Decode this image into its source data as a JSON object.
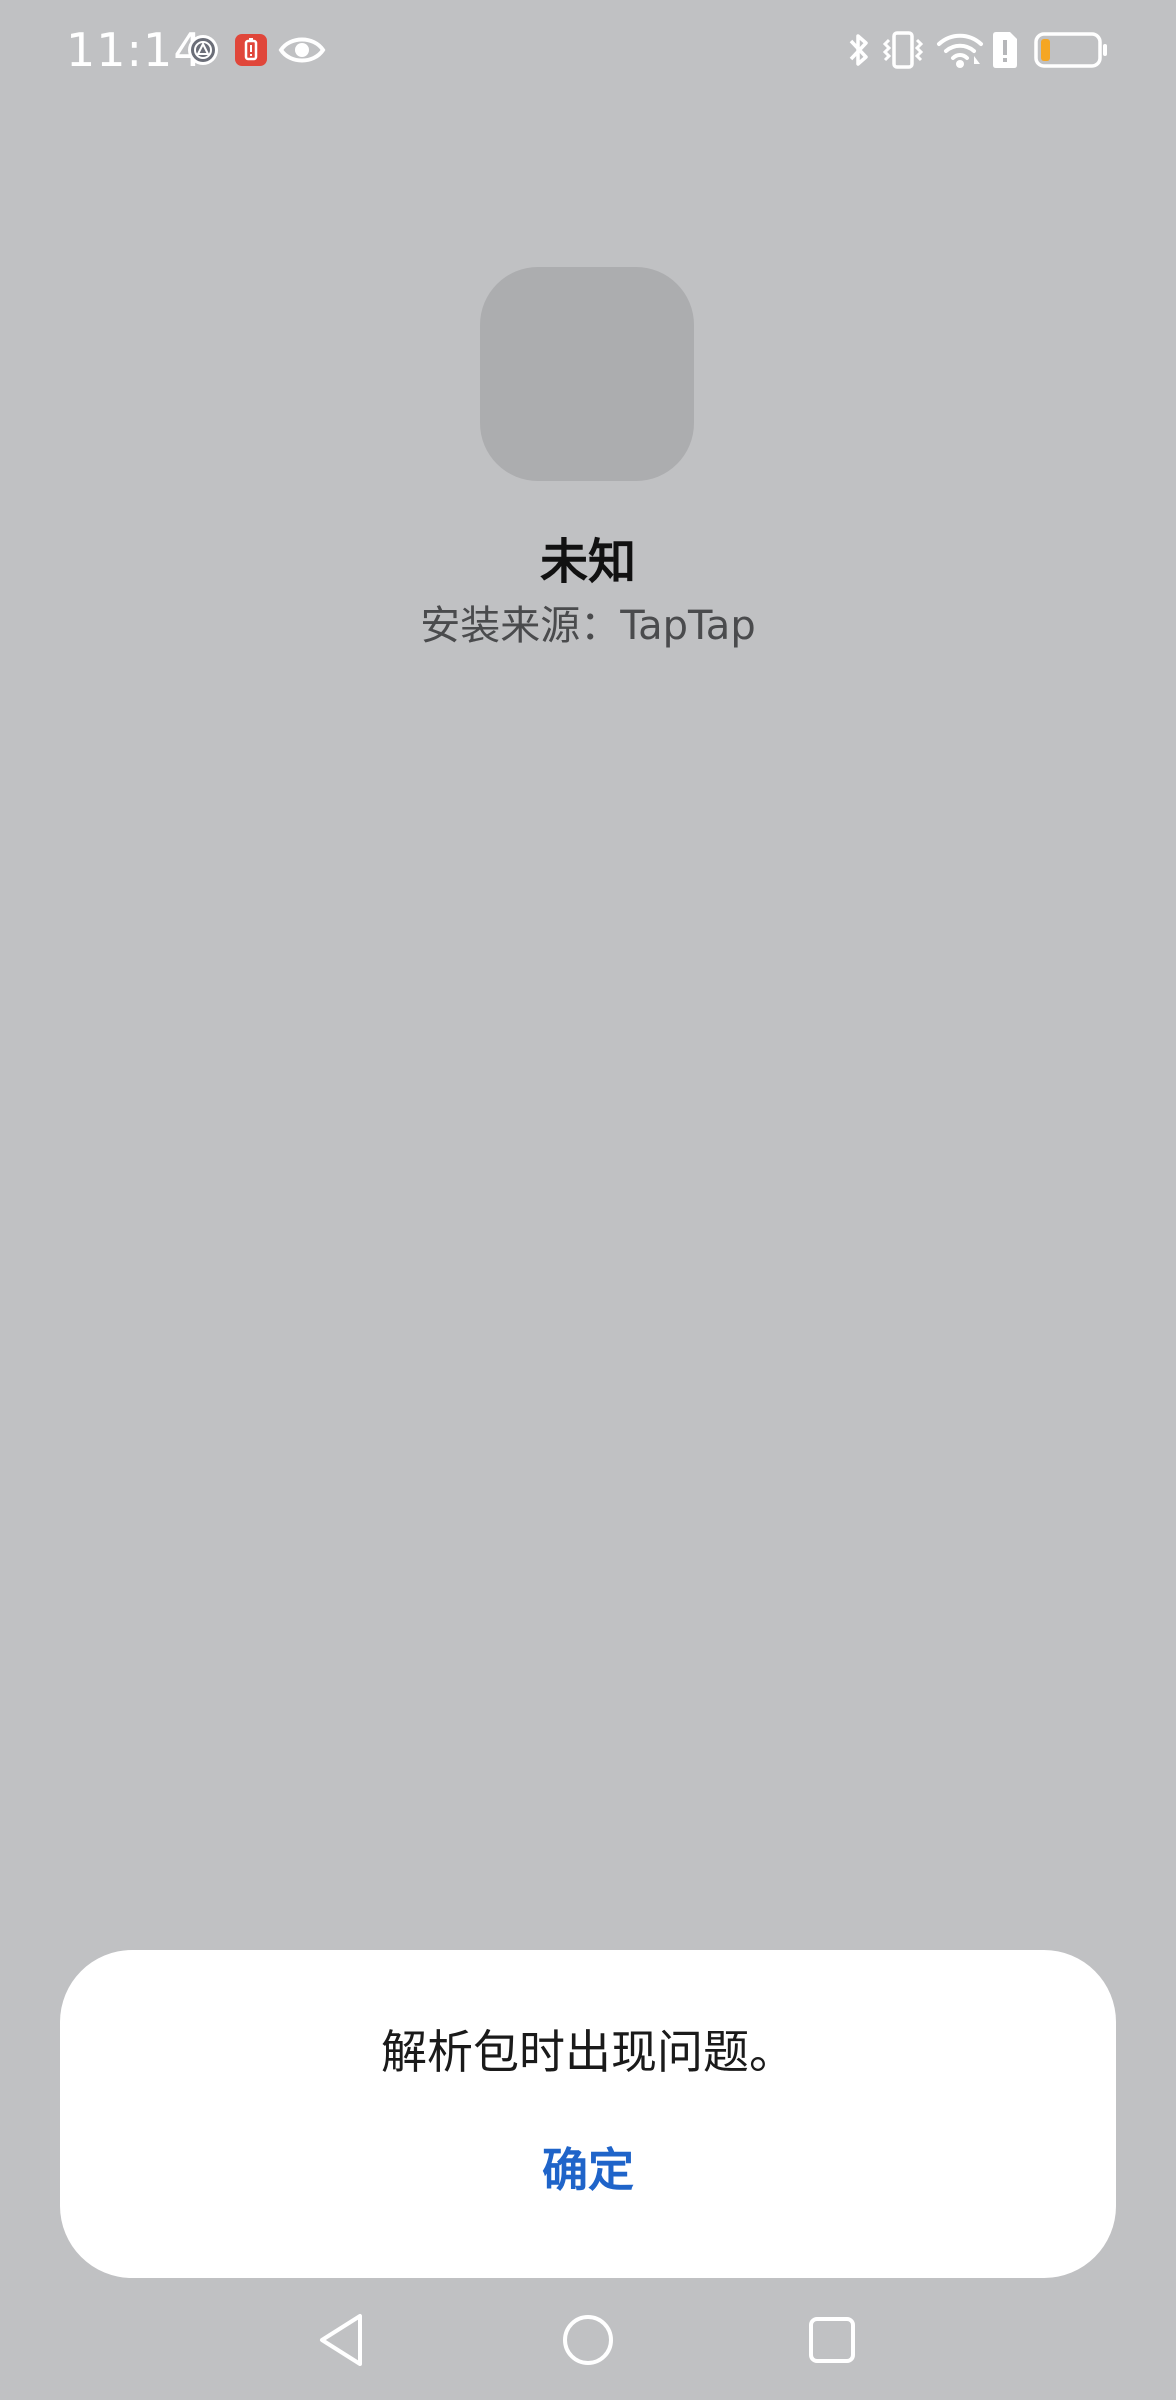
{
  "status_bar": {
    "time": "11:14",
    "left_icons": [
      "settings-icon",
      "battery-alert-icon",
      "eye-icon"
    ],
    "right_icons": [
      "bluetooth-icon",
      "vibrate-icon",
      "wifi-icon",
      "sim-alert-icon",
      "battery-icon"
    ],
    "battery_level": 0.12,
    "colors": {
      "icon": "#ffffff",
      "alert_badge": "#e0463a",
      "battery_low": "#f5a623"
    }
  },
  "app": {
    "name": "未知",
    "source": "安装来源：TapTap"
  },
  "dialog": {
    "message": "解析包时出现问题。",
    "confirm_label": "确定"
  },
  "navigation": {
    "buttons": [
      "back-icon",
      "home-icon",
      "recents-icon"
    ]
  },
  "colors": {
    "background": "#c0c1c3",
    "icon_placeholder": "#acadaf",
    "accent": "#1f64c9"
  }
}
